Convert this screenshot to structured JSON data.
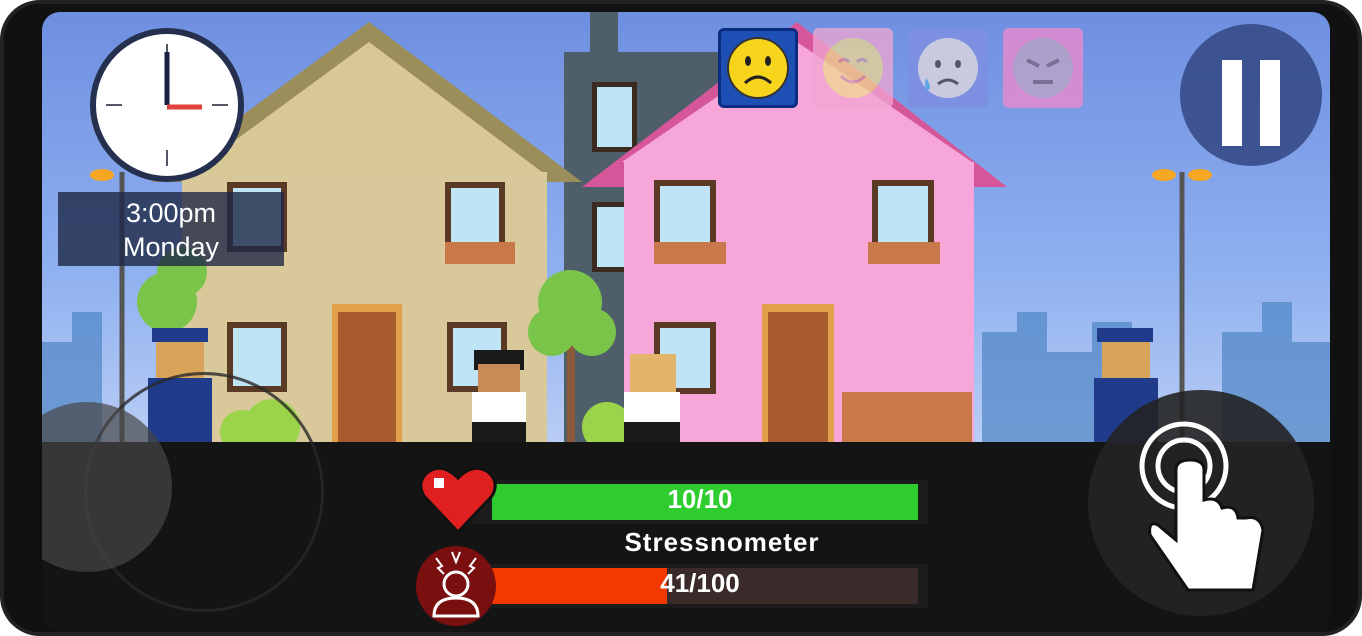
{
  "clock": {
    "time": "3:00pm",
    "day": "Monday"
  },
  "moods": [
    {
      "name": "sad",
      "active": true,
      "bg": "#1e4fb5",
      "face": "#f7d51d"
    },
    {
      "name": "happy",
      "active": false,
      "bg": "#f2a7d2",
      "face": "#f0d890"
    },
    {
      "name": "anxious",
      "active": false,
      "bg": "#7d8fe0",
      "face": "#c9c9e0"
    },
    {
      "name": "angry",
      "active": false,
      "bg": "#e48ad0",
      "face": "#b8a4c8"
    }
  ],
  "health": {
    "current": 10,
    "max": 10,
    "text": "10/10",
    "color": "#2ecc2e"
  },
  "stress": {
    "label": "Stressnometer",
    "current": 41,
    "max": 100,
    "text": "41/100",
    "color": "#f23a00"
  },
  "icons": {
    "pause": "pause-icon",
    "heart": "heart-icon",
    "stress": "stress-head-icon",
    "tap": "tap-hand-icon"
  }
}
